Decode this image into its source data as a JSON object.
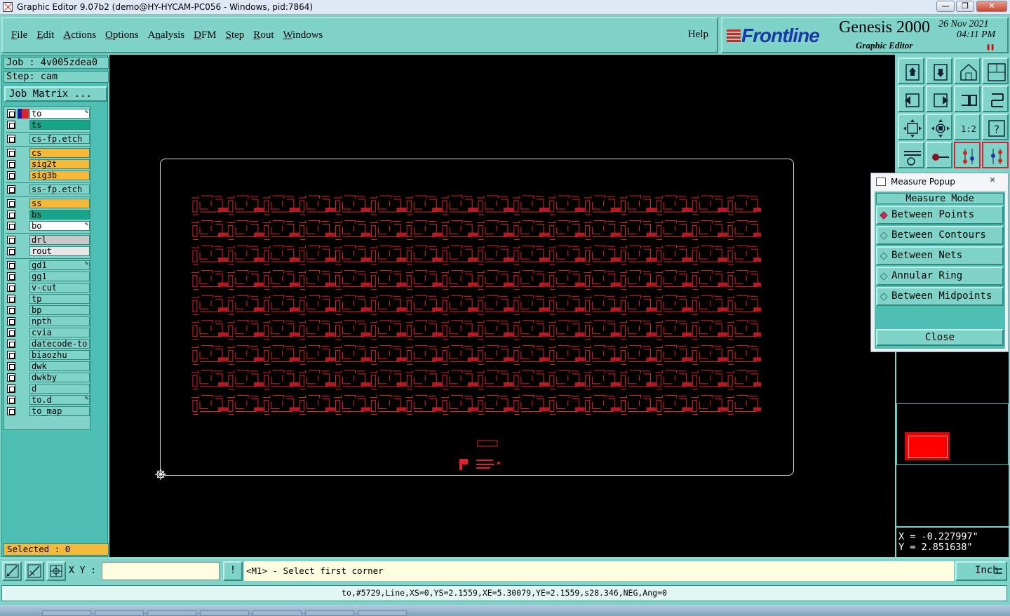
{
  "window": {
    "title": "Graphic Editor 9.07b2 (demo@HY-HYCAM-PC056 - Windows, pid:7864)",
    "controls": [
      "minimize",
      "maximize",
      "close"
    ]
  },
  "menubar": {
    "items": [
      {
        "label": "File",
        "key": "F"
      },
      {
        "label": "Edit",
        "key": "E"
      },
      {
        "label": "Actions",
        "key": "A"
      },
      {
        "label": "Options",
        "key": "O"
      },
      {
        "label": "Analysis",
        "key": "n"
      },
      {
        "label": "DFM",
        "key": "D"
      },
      {
        "label": "Step",
        "key": "S"
      },
      {
        "label": "Rout",
        "key": "R"
      },
      {
        "label": "Windows",
        "key": "W"
      }
    ],
    "help": "Help"
  },
  "brand": {
    "logo": "Frontline",
    "product": "Genesis 2000",
    "subtitle": "Graphic Editor",
    "date": "26 Nov 2021",
    "time": "04:11 PM"
  },
  "job": {
    "job_label": "Job : 4v005zdea0",
    "step_label": "Step: cam",
    "matrix_button": "Job Matrix ..."
  },
  "layers": [
    {
      "name": "to",
      "bg": "#ffffff",
      "swatch": "#e0202a",
      "swatch2": "#1a1aa8",
      "edit": true,
      "group": 0
    },
    {
      "name": "ts",
      "bg": "#17a589",
      "group": 0
    },
    {
      "name": "cs-fp.etch",
      "bg": "#7fd3c9",
      "group": 1
    },
    {
      "name": "cs",
      "bg": "#f5b93a",
      "group": 2
    },
    {
      "name": "sig2t",
      "bg": "#f5b93a",
      "group": 2
    },
    {
      "name": "sig3b",
      "bg": "#f5b93a",
      "group": 2
    },
    {
      "name": "ss-fp.etch",
      "bg": "#7fd3c9",
      "group": 3
    },
    {
      "name": "ss",
      "bg": "#f5b93a",
      "group": 4
    },
    {
      "name": "bs",
      "bg": "#17a589",
      "group": 4
    },
    {
      "name": "bo",
      "bg": "#ffffff",
      "edit": true,
      "group": 4
    },
    {
      "name": "drl",
      "bg": "#c9c9c9",
      "group": 5
    },
    {
      "name": "rout",
      "bg": "#e6e6e6",
      "group": 5
    },
    {
      "name": "gd1",
      "bg": "#7fd3c9",
      "edit": true,
      "group": 6
    },
    {
      "name": "gg1",
      "bg": "#7fd3c9",
      "group": 6
    },
    {
      "name": "v-cut",
      "bg": "#7fd3c9",
      "group": 6
    },
    {
      "name": "tp",
      "bg": "#7fd3c9",
      "group": 6
    },
    {
      "name": "bp",
      "bg": "#7fd3c9",
      "group": 6
    },
    {
      "name": "npth",
      "bg": "#7fd3c9",
      "group": 6
    },
    {
      "name": "cvia",
      "bg": "#7fd3c9",
      "group": 6
    },
    {
      "name": "datecode-to",
      "bg": "#7fd3c9",
      "group": 6
    },
    {
      "name": "biaozhu",
      "bg": "#7fd3c9",
      "group": 6
    },
    {
      "name": "dwk",
      "bg": "#7fd3c9",
      "group": 6
    },
    {
      "name": "dwkby",
      "bg": "#7fd3c9",
      "group": 6
    },
    {
      "name": "d",
      "bg": "#7fd3c9",
      "group": 6
    },
    {
      "name": "to.d",
      "bg": "#7fd3c9",
      "edit": true,
      "group": 6
    },
    {
      "name": "to_map",
      "bg": "#7fd3c9",
      "group": 6
    }
  ],
  "selected": "Selected : 0",
  "toolbar": {
    "buttons": [
      "zoom-fit-up-icon",
      "zoom-fit-down-icon",
      "home-icon",
      "panel-icon",
      "pan-left-icon",
      "pan-right-icon",
      "swap-icon",
      "redo-icon",
      "zoom-extents-icon",
      "zoom-center-icon",
      "ratio-icon",
      "help-icon",
      "settings-icon",
      "probe-icon",
      "layer-color-icon",
      "layer-color-alt-icon"
    ],
    "ratio_label": "1:2",
    "help_label": "?"
  },
  "measure_popup": {
    "title": "Measure Popup",
    "mode_label": "Measure Mode",
    "options": [
      {
        "label": "Between Points",
        "selected": true
      },
      {
        "label": "Between Contours",
        "selected": false
      },
      {
        "label": "Between Nets",
        "selected": false
      },
      {
        "label": "Annular Ring",
        "selected": false
      },
      {
        "label": "Between Midpoints",
        "selected": false
      }
    ],
    "close_label": "Close"
  },
  "coords": {
    "x": "X = -0.227997\"",
    "y": "Y = 2.851638\""
  },
  "bottombar": {
    "xy_label": "X Y :",
    "xy_value": "",
    "cmd_label": "!",
    "prompt": "<M1> - Select first corner",
    "units": "Inch"
  },
  "status_line": "to,#5729,Line,XS=0,YS=2.1559,XE=5.30079,YE=2.1559,s28.346,NEG,Ang=0",
  "panel_grid": {
    "rows": 9,
    "cols": 16
  },
  "colors": {
    "accent": "#7fd3c9",
    "panel": "#4dbfb3",
    "artwork": "#e0202a",
    "canvas": "#000000"
  }
}
